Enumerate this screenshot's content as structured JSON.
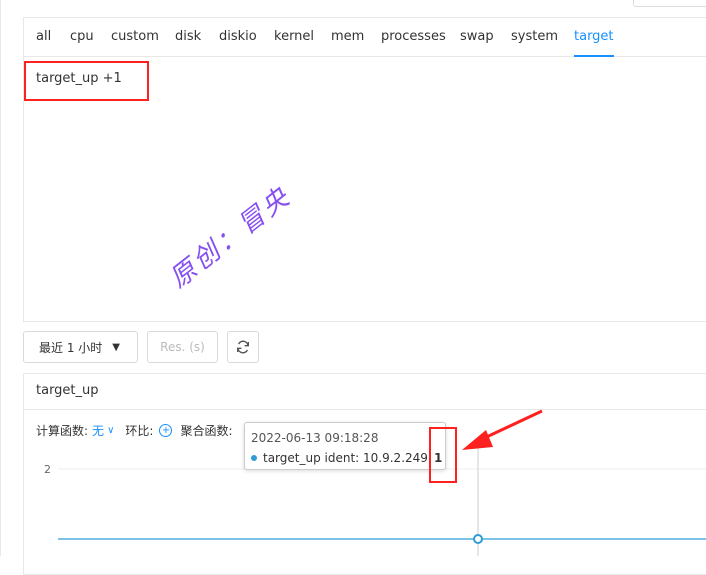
{
  "tabs": [
    "all",
    "cpu",
    "custom",
    "disk",
    "diskio",
    "kernel",
    "mem",
    "processes",
    "swap",
    "system",
    "target"
  ],
  "active_tab": "target",
  "metric_list": {
    "item": "target_up  +1"
  },
  "watermark": "原创：冒央",
  "toolbar": {
    "time_range": "最近 1 小时",
    "res_placeholder": "Res. (s)"
  },
  "chart": {
    "title": "target_up",
    "calc_label": "计算函数:",
    "calc_value": "无",
    "ratio_label": "环比:",
    "agg_label": "聚合函数:",
    "y_tick": "2",
    "tooltip": {
      "time": "2022-06-13 09:18:28",
      "series_label": "target_up ident: 10.9.2.249:",
      "value": "1"
    }
  },
  "colors": {
    "accent": "#1890ff",
    "annotation_red": "#ff2020",
    "series": "#2f9cd6"
  },
  "chart_data": {
    "type": "line",
    "title": "target_up",
    "series": [
      {
        "name": "target_up ident: 10.9.2.249",
        "values": [
          1,
          1,
          1,
          1,
          1
        ]
      }
    ],
    "x": [
      "",
      "",
      "",
      "2022-06-13 09:18:28",
      ""
    ],
    "yticks": [
      2
    ],
    "ylim": [
      0,
      2
    ]
  }
}
